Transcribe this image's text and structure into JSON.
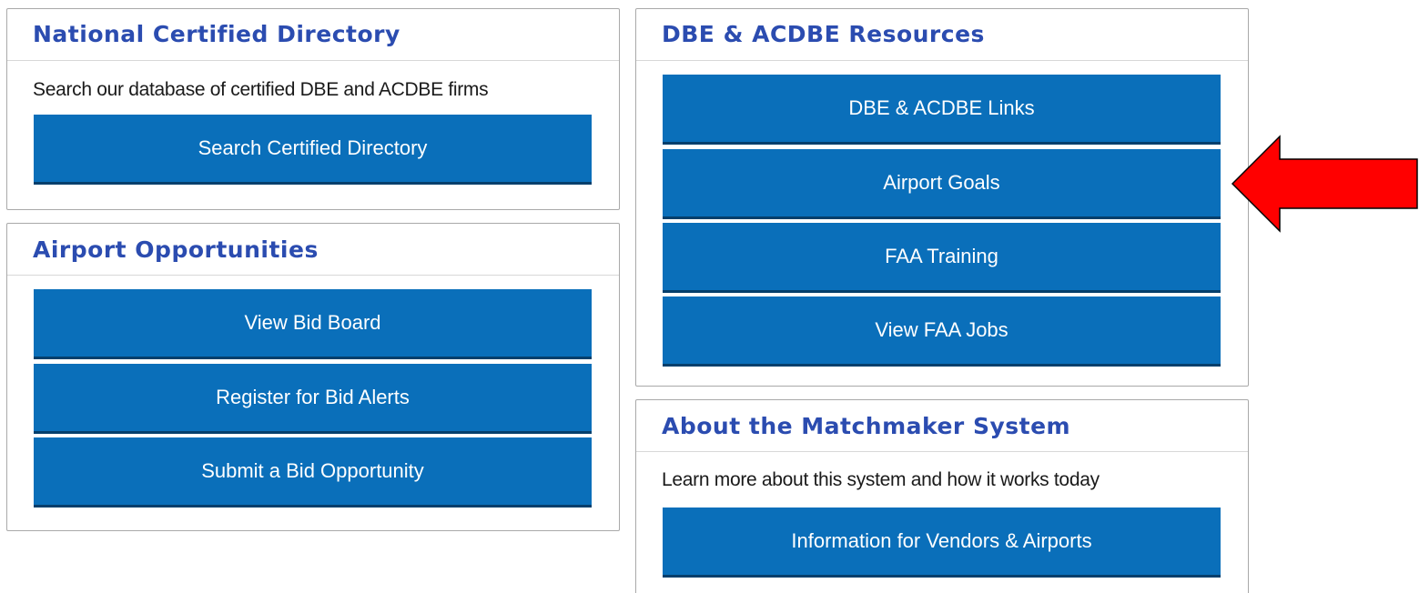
{
  "panels": {
    "directory": {
      "title": "National Certified Directory",
      "text": "Search our database of certified DBE and ACDBE firms",
      "buttons": [
        "Search Certified Directory"
      ]
    },
    "opportunities": {
      "title": "Airport Opportunities",
      "buttons": [
        "View Bid Board",
        "Register for Bid Alerts",
        "Submit a Bid Opportunity"
      ]
    },
    "resources": {
      "title": "DBE & ACDBE Resources",
      "buttons": [
        "DBE & ACDBE Links",
        "Airport Goals",
        "FAA Training",
        "View FAA Jobs"
      ]
    },
    "about": {
      "title": "About the Matchmaker System",
      "text": "Learn more about this system and how it works today",
      "buttons": [
        "Information for Vendors & Airports"
      ]
    }
  },
  "annotation": {
    "arrow_icon": "red-arrow-left-icon",
    "arrow_color": "#ff0000",
    "points_to": "Airport Goals"
  },
  "colors": {
    "button_bg": "#0a6fba",
    "title": "#2b4cb0"
  }
}
